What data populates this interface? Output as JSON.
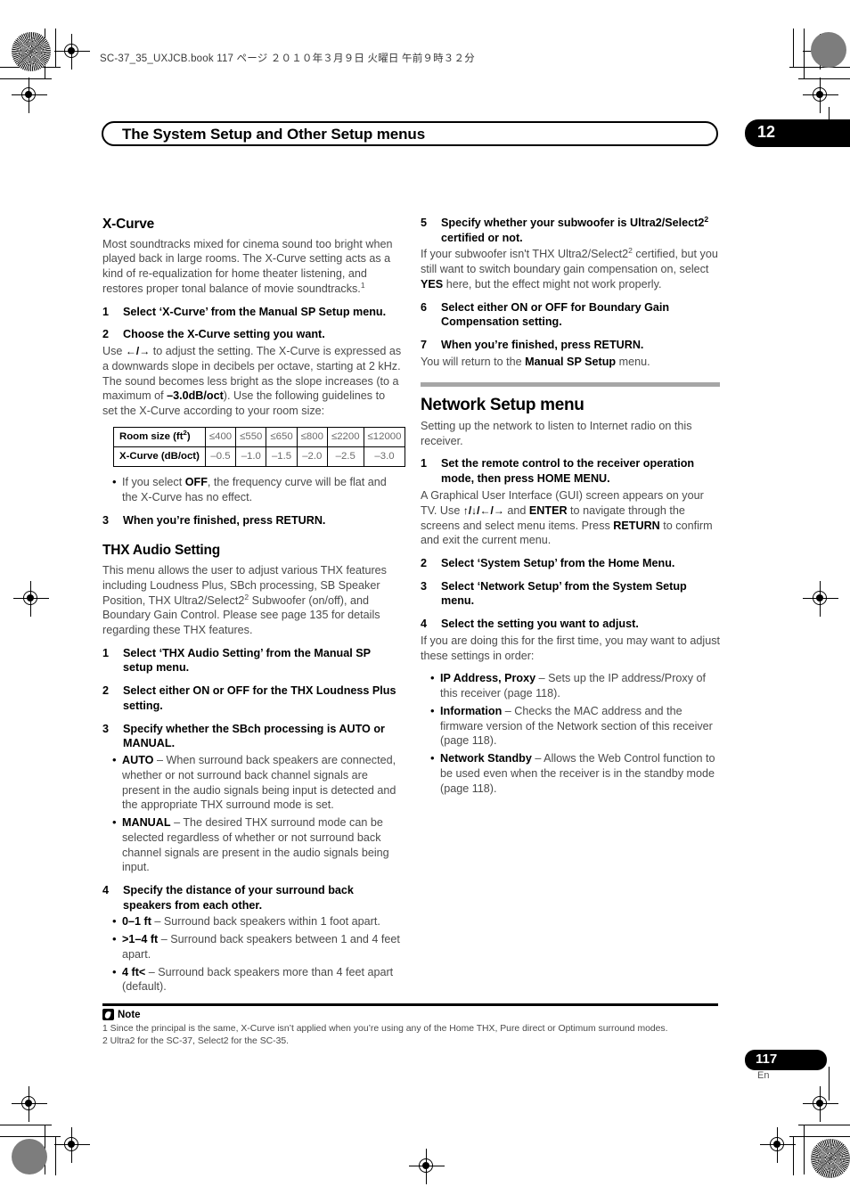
{
  "print_header": {
    "file_line": "SC-37_35_UXJCB.book   117 ページ   ２０１０年３月９日   火曜日   午前９時３２分"
  },
  "header": {
    "title": "The System Setup and Other Setup menus",
    "chapter": "12"
  },
  "left_column": {
    "xcurve": {
      "heading": "X-Curve",
      "intro": "Most soundtracks mixed for cinema sound too bright when played back in large rooms. The X-Curve setting acts as a kind of re-equalization for home theater listening, and restores proper tonal balance of movie soundtracks.",
      "intro_footnote": "1",
      "step1": {
        "num": "1",
        "text": "Select ‘X-Curve’ from the Manual SP Setup menu."
      },
      "step2": {
        "num": "2",
        "text": "Choose the X-Curve setting you want."
      },
      "step2_body_a": "Use ",
      "step2_arrows": "←/→",
      "step2_body_b": " to adjust the setting. The X-Curve is expressed as a downwards slope in decibels per octave, starting at 2 kHz. The sound becomes less bright as the slope increases (to a maximum of ",
      "step2_bold": "–3.0dB/oct",
      "step2_body_c": "). Use the following guidelines to set the X-Curve according to your room size:",
      "table": {
        "row1_header": "Room size (ft2)",
        "row1_header_base": "Room size (ft",
        "row1_header_sup": "2",
        "row1_header_end": ")",
        "row1_values": [
          "≤400",
          "≤550",
          "≤650",
          "≤800",
          "≤2200",
          "≤12000"
        ],
        "row2_header": "X-Curve (dB/oct)",
        "row2_values": [
          "–0.5",
          "–1.0",
          "–1.5",
          "–2.0",
          "–2.5",
          "–3.0"
        ]
      },
      "bullet_off_a": "If you select ",
      "bullet_off_bold": "OFF",
      "bullet_off_b": ", the frequency curve will be flat and the X-Curve has no effect.",
      "step3": {
        "num": "3",
        "text": "When you’re finished, press RETURN."
      }
    },
    "thx": {
      "heading": "THX Audio Setting",
      "intro_a": "This menu allows the user to adjust various THX features including Loudness Plus, SBch processing, SB Speaker Position, THX Ultra2/Select2",
      "intro_sup": "2",
      "intro_b": " Subwoofer (on/off), and Boundary Gain Control. Please see page 135 for details regarding these THX features.",
      "step1": {
        "num": "1",
        "text": "Select ‘THX Audio Setting’ from the Manual SP setup menu."
      },
      "step2": {
        "num": "2",
        "text": "Select either ON or OFF for the THX Loudness Plus setting."
      },
      "step3": {
        "num": "3",
        "text": "Specify whether the SBch processing is AUTO or MANUAL."
      },
      "step3_bullets": [
        {
          "term": "AUTO",
          "desc": " – When surround back speakers are connected, whether or not surround back channel signals are present in the audio signals being input is detected and the appropriate THX surround mode is set."
        },
        {
          "term": "MANUAL",
          "desc": " – The desired THX surround mode can be selected regardless of whether or not surround back channel signals are present in the audio signals being input."
        }
      ],
      "step4": {
        "num": "4",
        "text": "Specify the distance of your surround back speakers from each other."
      },
      "step4_bullets": [
        {
          "term": "0–1 ft",
          "desc": " – Surround back speakers within 1 foot apart."
        },
        {
          "term": ">1–4 ft",
          "desc": " – Surround back speakers between 1 and 4 feet apart."
        },
        {
          "term": "4 ft<",
          "desc": " – Surround back speakers more than 4 feet apart (default)."
        }
      ]
    }
  },
  "right_column": {
    "thx_cont": {
      "step5": {
        "num": "5",
        "text_a": "Specify whether your subwoofer is Ultra2/Select2",
        "sup": "2",
        "text_b": " certified or not."
      },
      "step5_body_a": "If your subwoofer isn't THX Ultra2/Select2",
      "step5_body_sup": "2",
      "step5_body_b": " certified, but you still want to switch boundary gain compensation on, select ",
      "step5_body_bold": "YES",
      "step5_body_c": " here, but the effect might not work properly.",
      "step6": {
        "num": "6",
        "text": "Select either ON or OFF for Boundary Gain Compensation setting."
      },
      "step7": {
        "num": "7",
        "text": "When you’re finished, press RETURN."
      },
      "step7_body_a": "You will return to the ",
      "step7_body_bold": "Manual SP Setup",
      "step7_body_b": " menu."
    },
    "network": {
      "heading": "Network Setup menu",
      "intro": "Setting up the network to listen to Internet radio on this receiver.",
      "step1": {
        "num": "1",
        "text": "Set the remote control to the receiver operation mode, then press HOME MENU."
      },
      "step1_body_a": "A Graphical User Interface (GUI) screen appears on your TV. Use ",
      "step1_arrows": "↑/↓/←/→",
      "step1_body_b": " and ",
      "step1_bold1": "ENTER",
      "step1_body_c": " to navigate through the screens and select menu items. Press ",
      "step1_bold2": "RETURN",
      "step1_body_d": " to confirm and exit the current menu.",
      "step2": {
        "num": "2",
        "text": "Select ‘System Setup’ from the Home Menu."
      },
      "step3": {
        "num": "3",
        "text": "Select ‘Network Setup’ from the System Setup menu."
      },
      "step4": {
        "num": "4",
        "text": "Select the setting you want to adjust."
      },
      "step4_body": "If you are doing this for the first time, you may want to adjust these settings in order:",
      "step4_bullets": [
        {
          "term": "IP Address, Proxy",
          "desc": " – Sets up the IP address/Proxy of this receiver (page 118)."
        },
        {
          "term": "Information",
          "desc": " – Checks the MAC address and the firmware version of the Network section of this receiver (page 118)."
        },
        {
          "term": "Network Standby",
          "desc": " – Allows the Web Control function to be used even when the receiver is in the standby mode (page 118)."
        }
      ]
    }
  },
  "notes": {
    "label": "Note",
    "items": [
      "1 Since the principal is the same, X-Curve isn’t applied when you’re using any of the Home THX, Pure direct or Optimum surround modes.",
      "2 Ultra2 for the SC-37, Select2 for the SC-35."
    ]
  },
  "footer": {
    "page_number": "117",
    "language": "En"
  }
}
